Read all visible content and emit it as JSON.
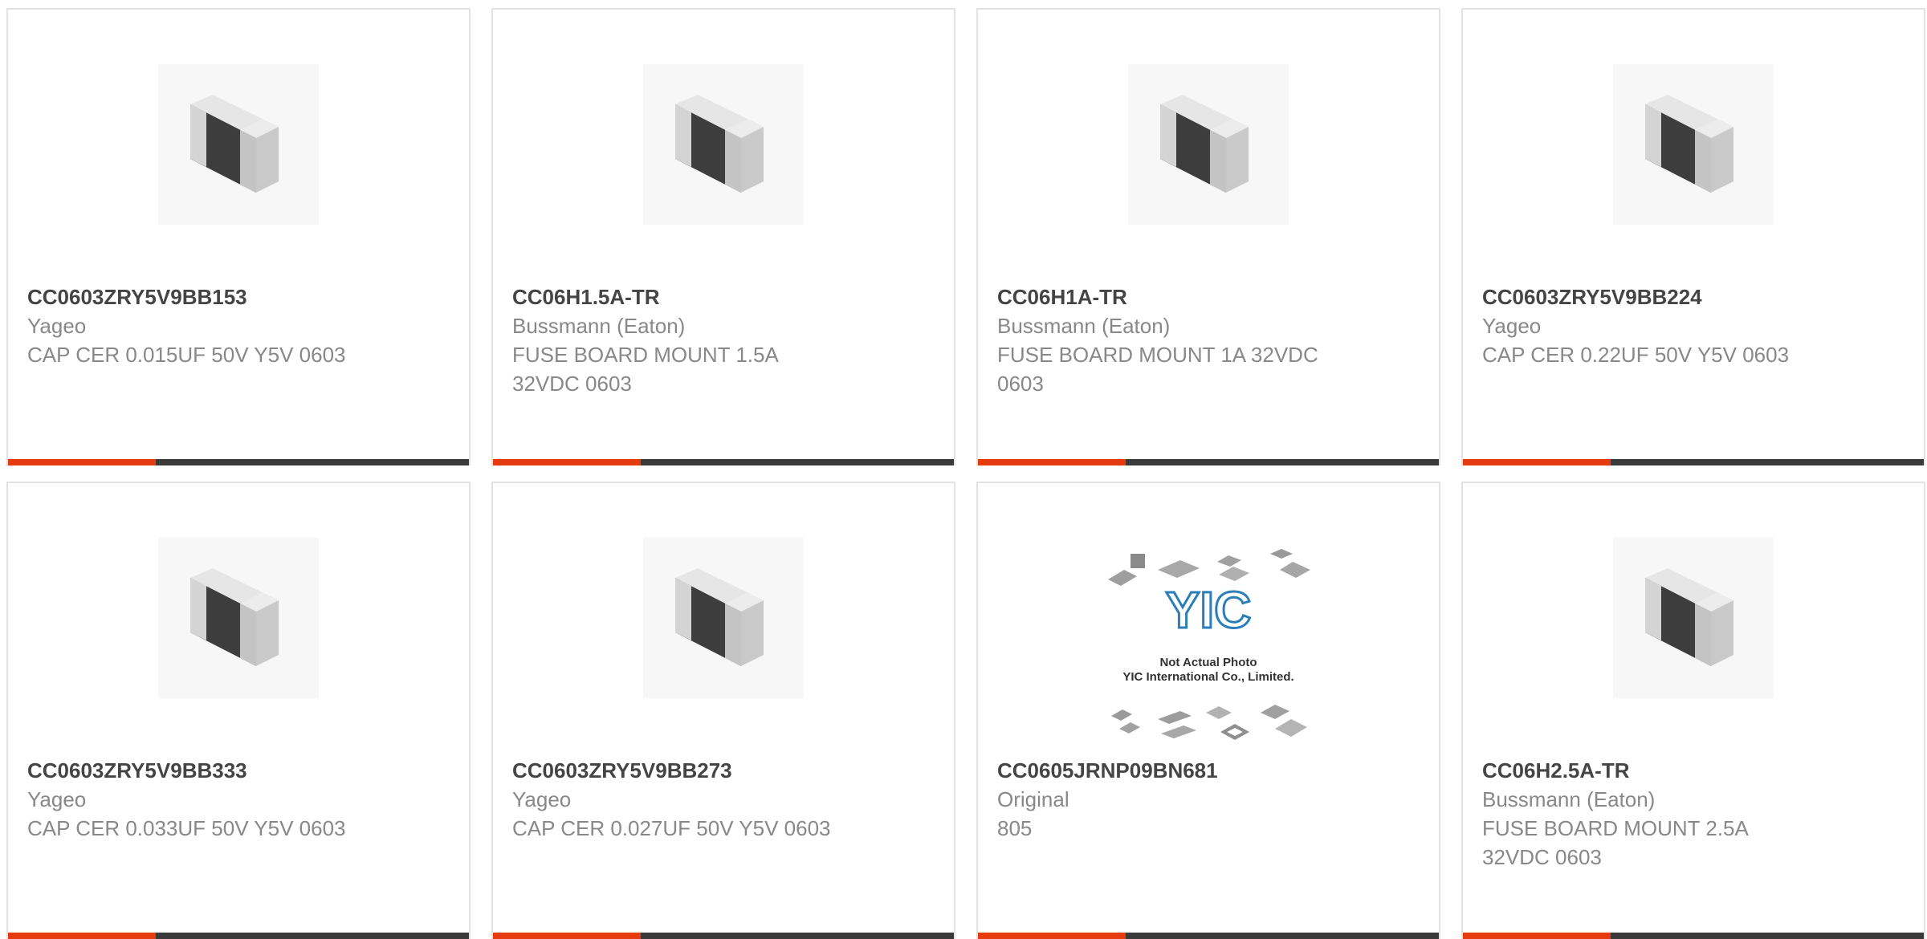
{
  "products": [
    {
      "part": "CC0603ZRY5V9BB153",
      "maker": "Yageo",
      "desc": "CAP CER 0.015UF 50V Y5V 0603",
      "icon": "chip-component-image",
      "bar_fill": 0.32
    },
    {
      "part": "CC06H1.5A-TR",
      "maker": "Bussmann (Eaton)",
      "desc": "FUSE BOARD MOUNT 1.5A 32VDC 0603",
      "icon": "chip-component-image",
      "bar_fill": 0.32
    },
    {
      "part": "CC06H1A-TR",
      "maker": "Bussmann (Eaton)",
      "desc": "FUSE BOARD MOUNT 1A 32VDC 0603",
      "icon": "chip-component-image",
      "bar_fill": 0.32
    },
    {
      "part": "CC0603ZRY5V9BB224",
      "maker": "Yageo",
      "desc": "CAP CER 0.22UF 50V Y5V 0603",
      "icon": "chip-component-image",
      "bar_fill": 0.32
    },
    {
      "part": "CC0603ZRY5V9BB333",
      "maker": "Yageo",
      "desc": "CAP CER 0.033UF 50V Y5V 0603",
      "icon": "chip-component-image",
      "bar_fill": 0.32
    },
    {
      "part": "CC0603ZRY5V9BB273",
      "maker": "Yageo",
      "desc": "CAP CER 0.027UF 50V Y5V 0603",
      "icon": "chip-component-image",
      "bar_fill": 0.32
    },
    {
      "part": "CC0605JRNP09BN681",
      "maker": "Original",
      "desc": "805",
      "icon": "not-actual-photo-placeholder",
      "placeholder_text": [
        "Not Actual Photo",
        "YIC International Co., Limited."
      ],
      "placeholder_logo": "YIC",
      "bar_fill": 0.32
    },
    {
      "part": "CC06H2.5A-TR",
      "maker": "Bussmann (Eaton)",
      "desc": "FUSE BOARD MOUNT 2.5A 32VDC 0603",
      "icon": "chip-component-image",
      "bar_fill": 0.32
    }
  ],
  "colors": {
    "accent": "#e63b0e",
    "bar": "#3a3a3a",
    "part_text": "#444444",
    "meta_text": "#888888",
    "border": "#e3e3e3"
  }
}
